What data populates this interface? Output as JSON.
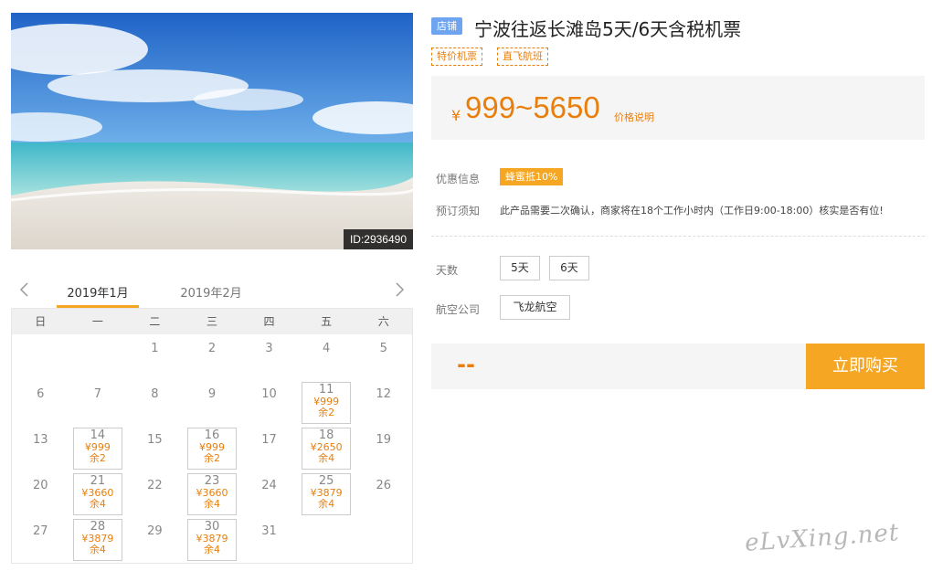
{
  "hero": {
    "id_label": "ID:2936490"
  },
  "product": {
    "shop_badge": "店铺",
    "title": "宁波往返长滩岛5天/6天含税机票",
    "tags": [
      "特价机票",
      "直飞航班"
    ],
    "price_currency": "¥",
    "price_range": "999~5650",
    "price_explain": "价格说明"
  },
  "info": {
    "promo_label": "优惠信息",
    "promo_badge": "蜂蜜抵10%",
    "notice_label": "预订须知",
    "notice_text": "此产品需要二次确认，商家将在18个工作小时内（工作日9:00-18:00）核实是否有位!"
  },
  "options": {
    "days_label": "天数",
    "days": [
      "5天",
      "6天"
    ],
    "airline_label": "航空公司",
    "airline": "飞龙航空"
  },
  "purchase": {
    "total": "--",
    "buy_label": "立即购买"
  },
  "calendar": {
    "months": [
      "2019年1月",
      "2019年2月"
    ],
    "active_month": 0,
    "weekdays": [
      "日",
      "一",
      "二",
      "三",
      "四",
      "五",
      "六"
    ],
    "leading_blanks": 2,
    "days_in_month": 31,
    "available": {
      "11": {
        "price": "¥999",
        "remain": "余2"
      },
      "14": {
        "price": "¥999",
        "remain": "余2"
      },
      "16": {
        "price": "¥999",
        "remain": "余2"
      },
      "18": {
        "price": "¥2650",
        "remain": "余4"
      },
      "21": {
        "price": "¥3660",
        "remain": "余4"
      },
      "23": {
        "price": "¥3660",
        "remain": "余4"
      },
      "25": {
        "price": "¥3879",
        "remain": "余4"
      },
      "28": {
        "price": "¥3879",
        "remain": "余4"
      },
      "30": {
        "price": "¥3879",
        "remain": "余4"
      }
    }
  },
  "watermark": "eLvXing.net",
  "colors": {
    "accent": "#f5a623",
    "price": "#e87f0c",
    "shop_badge": "#6ea4f0"
  }
}
